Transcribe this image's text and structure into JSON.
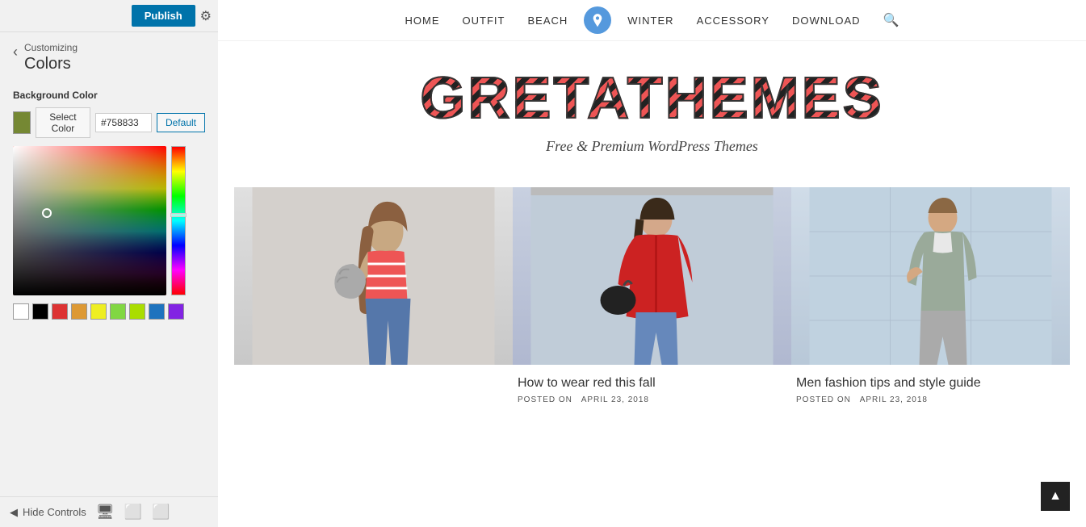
{
  "topbar": {
    "publish_label": "Publish",
    "settings_icon": "⚙"
  },
  "breadcrumb": {
    "back_icon": "‹",
    "parent": "Customizing",
    "title": "Colors"
  },
  "color_section": {
    "bg_color_label": "Background Color",
    "select_color_btn": "Select Color",
    "hex_value": "#758833",
    "default_btn": "Default"
  },
  "swatches": [
    {
      "color": "#ffffff",
      "name": "white"
    },
    {
      "color": "#000000",
      "name": "black"
    },
    {
      "color": "#dd3333",
      "name": "red"
    },
    {
      "color": "#dd9933",
      "name": "orange"
    },
    {
      "color": "#eeee22",
      "name": "yellow"
    },
    {
      "color": "#81d742",
      "name": "light-green"
    },
    {
      "color": "#aadd00",
      "name": "yellow-green"
    },
    {
      "color": "#1e73be",
      "name": "blue"
    },
    {
      "color": "#8224e3",
      "name": "purple"
    }
  ],
  "bottom": {
    "hide_controls_icon": "◀",
    "hide_controls_label": "Hide Controls",
    "desktop_icon": "🖥",
    "tablet_icon": "⬜",
    "mobile_icon": "⬜"
  },
  "site": {
    "nav_items": [
      "HOME",
      "OUTFIT",
      "BEACH",
      "WINTER",
      "ACCESSORY",
      "DOWNLOAD"
    ],
    "brand_title": "GRETATHEMES",
    "tagline": "Free & Premium WordPress Themes"
  },
  "cards": [
    {
      "title": "",
      "posted_label": "",
      "date": "",
      "type": "large-image"
    },
    {
      "title": "How to wear red this fall",
      "posted_label": "POSTED ON",
      "date": "APRIL 23, 2018"
    },
    {
      "title": "Men fashion tips and style guide",
      "posted_label": "POSTED ON",
      "date": "APRIL 23, 2018"
    }
  ]
}
